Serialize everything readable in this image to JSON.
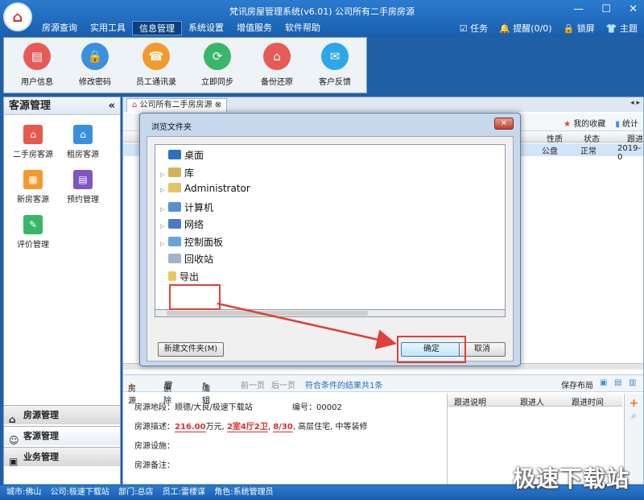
{
  "window": {
    "title": "梵讯房屋管理系统(v6.01) 公司所有二手房房源",
    "min": "—",
    "max": "☐",
    "close": "✕"
  },
  "menu": [
    {
      "label": "房源查询"
    },
    {
      "label": "实用工具"
    },
    {
      "label": "信息管理"
    },
    {
      "label": "系统设置"
    },
    {
      "label": "增值服务"
    },
    {
      "label": "软件帮助"
    }
  ],
  "topright": {
    "task": "任务",
    "reminder": "提醒(0/0)",
    "lock": "锁屏",
    "theme": "主题"
  },
  "toolbar": [
    {
      "label": "用户信息",
      "color": "#e85a55",
      "icon": "▤"
    },
    {
      "label": "修改密码",
      "color": "#3a8fe0",
      "icon": "🔒"
    },
    {
      "label": "员工通讯录",
      "color": "#f39a2c",
      "icon": "☎"
    },
    {
      "label": "立即同步",
      "color": "#3ab66a",
      "icon": "⟳"
    },
    {
      "label": "备份还原",
      "color": "#e85a55",
      "icon": "⌂"
    },
    {
      "label": "客户反馈",
      "color": "#2ea6e8",
      "icon": "✉"
    }
  ],
  "leftpane": {
    "title": "客源管理",
    "collapse": "«",
    "items": [
      {
        "label": "二手房客源",
        "color": "#e8584f"
      },
      {
        "label": "租房客源",
        "color": "#3a8fe0"
      },
      {
        "label": "新房客源",
        "color": "#f39a2c"
      },
      {
        "label": "预约管理",
        "color": "#7e57c2"
      },
      {
        "label": "评价管理",
        "color": "#3ab66a"
      }
    ],
    "nav": [
      {
        "label": "房源管理",
        "icon": "⌂"
      },
      {
        "label": "客源管理",
        "icon": "☺"
      },
      {
        "label": "业务管理",
        "icon": "▣"
      }
    ]
  },
  "tab": {
    "label": "公司所有二手房房源",
    "close": "⊗",
    "arrows": "◂ ▸"
  },
  "gridtools": {
    "fav": "我的收藏",
    "stats": "统计"
  },
  "grid": {
    "headers": [
      "性质",
      "状态",
      "跟进"
    ],
    "row": [
      "公盘",
      "正常",
      "2019-0"
    ]
  },
  "bottomtools": {
    "add": "房源",
    "del": "删除",
    "edit": "编辑",
    "prev": "前一页",
    "next": "后一页",
    "result": "符合条件的结果共1条",
    "save": "保存布局"
  },
  "detail": {
    "addr_label": "房源地段：",
    "addr": "顺德/大良/极速下载站",
    "no_label": "编号：",
    "no": "00002",
    "desc_label": "房源描述：",
    "price": "216.00",
    "price_unit": "万元,",
    "rooms": "2室4厅2卫",
    "floor": "8/30",
    "desc_rest": ", 高层住宅, 中等装修",
    "facility_label": "房源设施：",
    "note_label": "房源备注："
  },
  "follow": {
    "headers": [
      "跟进说明",
      "跟进人",
      "跟进时间"
    ]
  },
  "statusbar": {
    "city": "城市:佛山",
    "company": "公司:极速下载站",
    "dept": "部门:总店",
    "staff": "员工:雷楼谋",
    "role": "角色:系统管理员"
  },
  "watermark": "极速下载站",
  "dialog": {
    "title": "浏览文件夹",
    "close": "✕",
    "nodes": [
      {
        "label": "桌面",
        "arrow": ""
      },
      {
        "label": "库",
        "arrow": "▷"
      },
      {
        "label": "Administrator",
        "arrow": "▷"
      },
      {
        "label": "计算机",
        "arrow": "▷"
      },
      {
        "label": "网络",
        "arrow": "▷"
      },
      {
        "label": "控制面板",
        "arrow": "▷"
      },
      {
        "label": "回收站",
        "arrow": ""
      },
      {
        "label": "导出",
        "arrow": ""
      }
    ],
    "newfolder": "新建文件夹(M)",
    "ok": "确定",
    "cancel": "取消"
  }
}
